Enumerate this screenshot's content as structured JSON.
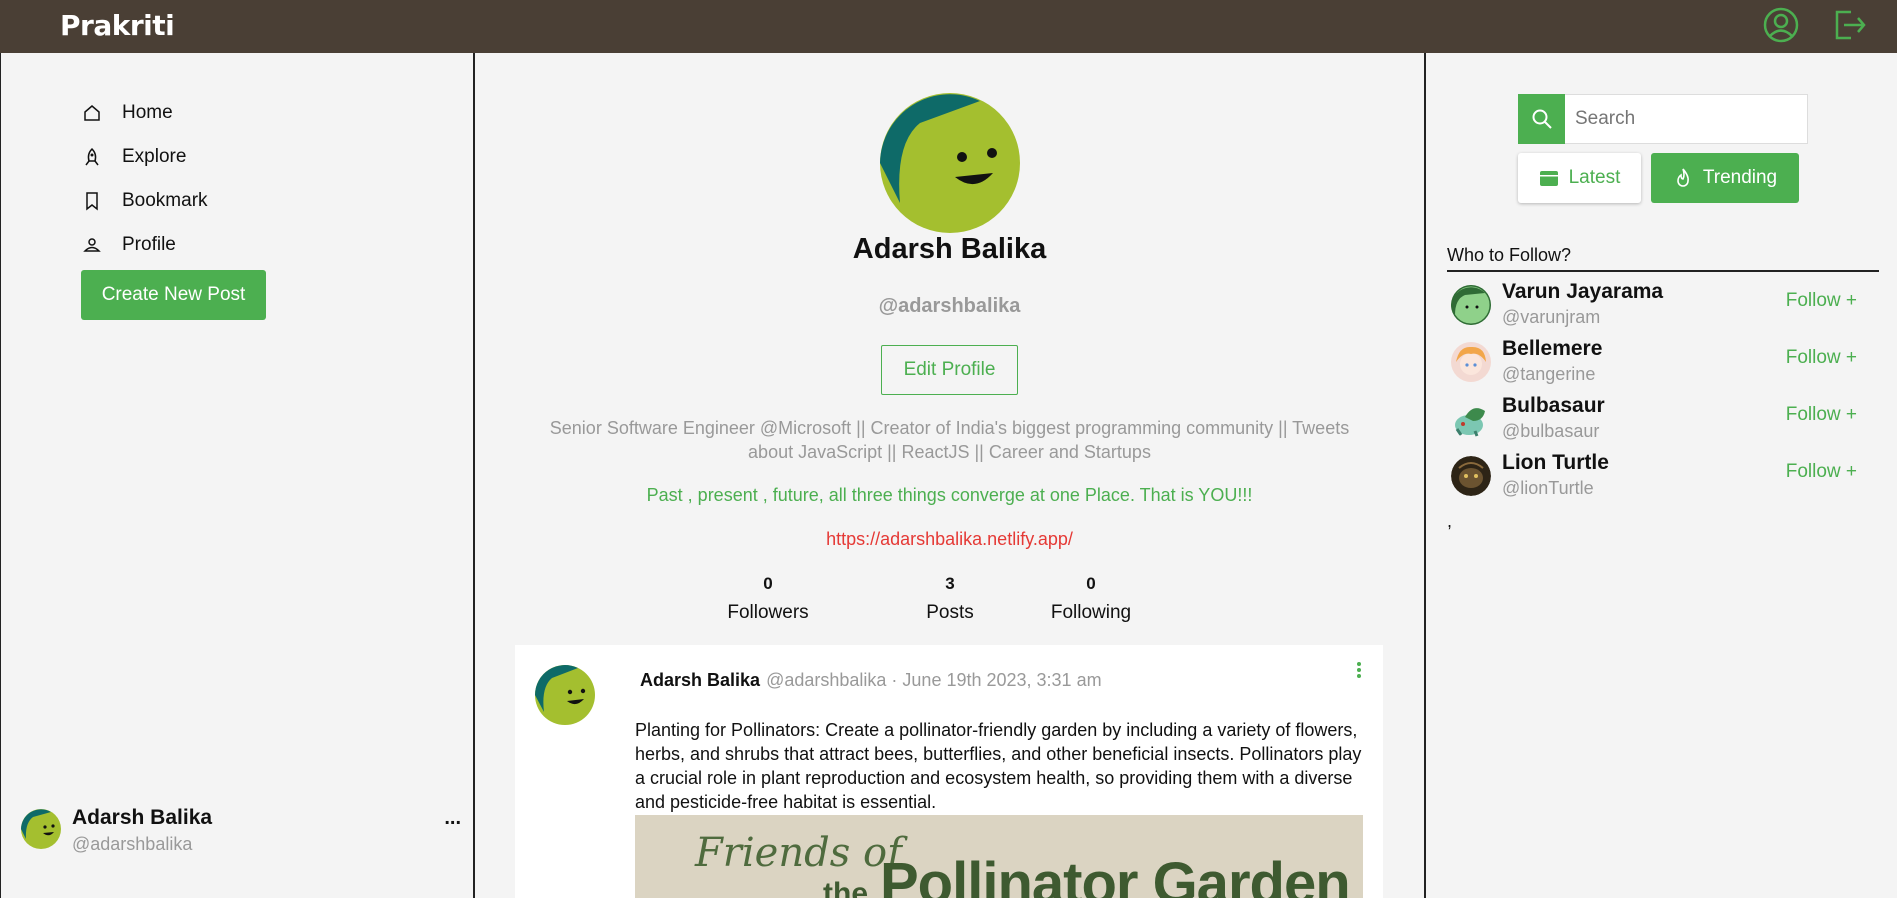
{
  "app": {
    "brand": "Prakriti"
  },
  "colors": {
    "topbar": "#4a3f35",
    "accent": "#4caf50",
    "link": "#e53935"
  },
  "topbar": {
    "icons": [
      "user-circle-icon",
      "logout-icon"
    ]
  },
  "sidebar": {
    "items": [
      {
        "label": "Home",
        "icon": "home-icon"
      },
      {
        "label": "Explore",
        "icon": "rocket-icon"
      },
      {
        "label": "Bookmark",
        "icon": "bookmark-icon"
      },
      {
        "label": "Profile",
        "icon": "user-icon"
      }
    ],
    "create_label": "Create New Post",
    "user": {
      "name": "Adarsh Balika",
      "handle": "@adarshbalika",
      "menu": "..."
    }
  },
  "profile": {
    "name": "Adarsh Balika",
    "handle": "@adarshbalika",
    "edit_label": "Edit Profile",
    "bio": "Senior Software Engineer @Microsoft || Creator of India's biggest programming community || Tweets about JavaScript || ReactJS || Career and Startups",
    "quote": "Past , present , future, all three things converge at one Place. That is YOU!!!",
    "link": "https://adarshbalika.netlify.app/",
    "stats": [
      {
        "value": "0",
        "label": "Followers"
      },
      {
        "value": "3",
        "label": "Posts"
      },
      {
        "value": "0",
        "label": "Following"
      }
    ]
  },
  "post": {
    "author": "Adarsh Balika",
    "handle": "@adarshbalika",
    "date": "· June 19th 2023, 3:31 am",
    "text": "Planting for Pollinators: Create a pollinator-friendly garden by including a variety of flowers, herbs, and shrubs that attract bees, butterflies, and other beneficial insects. Pollinators play a crucial role in plant reproduction and ecosystem health, so providing them with a diverse and pesticide-free habitat is essential.",
    "image_text": {
      "line1": "Friends of",
      "line2": "Pollinator Garden",
      "line3": "the"
    }
  },
  "right": {
    "search_placeholder": "Search",
    "tabs": [
      {
        "label": "Latest",
        "icon": "calendar-icon"
      },
      {
        "label": "Trending",
        "icon": "fire-icon"
      }
    ],
    "who_to_follow": "Who to Follow?",
    "suggestions": [
      {
        "name": "Varun Jayarama",
        "handle": "@varunjram",
        "action": "Follow +"
      },
      {
        "name": "Bellemere",
        "handle": "@tangerine",
        "action": "Follow +"
      },
      {
        "name": "Bulbasaur",
        "handle": "@bulbasaur",
        "action": "Follow +"
      },
      {
        "name": "Lion Turtle",
        "handle": "@lionTurtle",
        "action": "Follow +"
      }
    ],
    "trailing": ","
  }
}
